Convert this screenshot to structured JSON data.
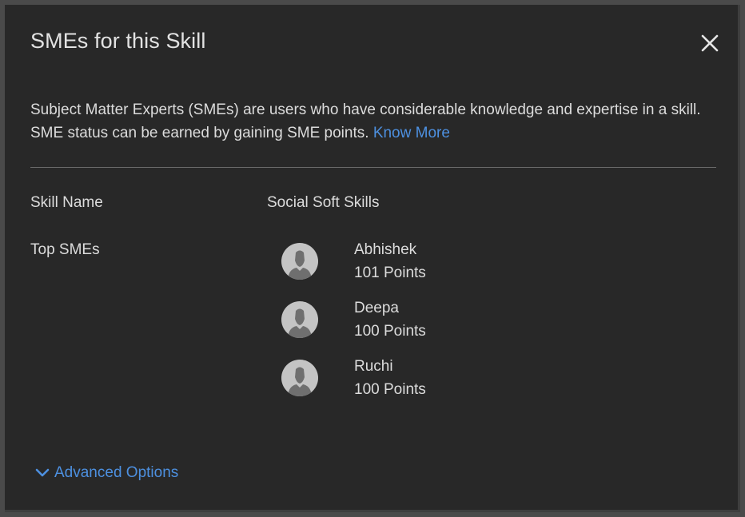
{
  "dialog": {
    "title": "SMEs for this Skill",
    "close_icon": "close-icon",
    "description": "Subject Matter Experts (SMEs) are users who have considerable knowledge and expertise in a skill. SME status can be earned by gaining SME points.",
    "know_more_label": "Know More",
    "skill_name_label": "Skill Name",
    "skill_name_value": "Social Soft Skills",
    "top_smes_label": "Top SMEs",
    "smes": [
      {
        "name": "Abhishek",
        "points": "101 Points",
        "avatar_icon": "user-avatar-icon"
      },
      {
        "name": "Deepa",
        "points": "100 Points",
        "avatar_icon": "user-avatar-icon"
      },
      {
        "name": "Ruchi",
        "points": "100 Points",
        "avatar_icon": "user-avatar-icon"
      }
    ],
    "advanced_options_label": "Advanced Options",
    "advanced_icon": "chevron-down-icon"
  },
  "colors": {
    "background": "#282828",
    "text": "#dcdcdc",
    "title": "#e2e2e2",
    "link": "#4d90e0",
    "avatar": "#c4c4c4"
  }
}
